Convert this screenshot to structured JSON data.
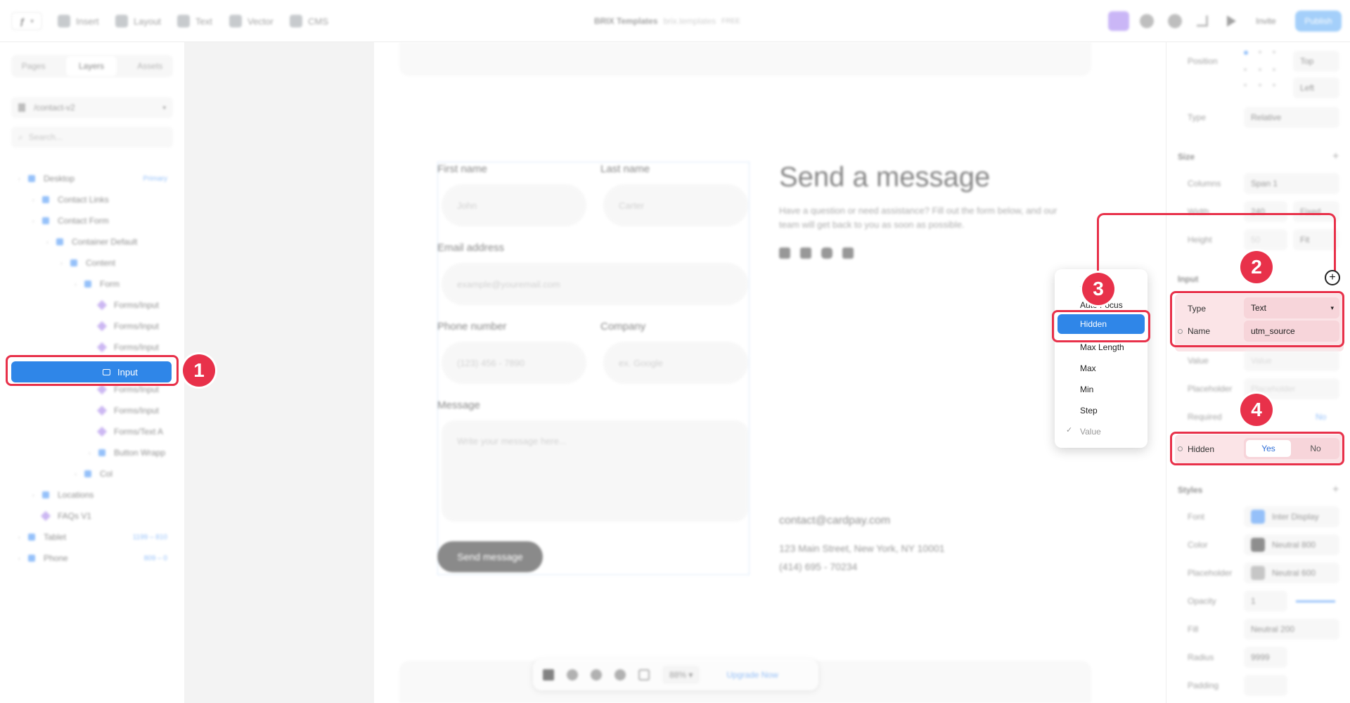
{
  "toolbar": {
    "menu": [
      "Insert",
      "Layout",
      "Text",
      "Vector",
      "CMS"
    ],
    "project": "BRIX Templates",
    "domain": "brix.templates",
    "plan": "FREE",
    "invite": "Invite",
    "publish": "Publish"
  },
  "left_panel": {
    "tabs": [
      "Pages",
      "Layers",
      "Assets"
    ],
    "page_select": "/contact-v2",
    "search_placeholder": "Search...",
    "layers": [
      {
        "label": "Desktop",
        "tag": "Primary",
        "kind": "frame",
        "indent": 0
      },
      {
        "label": "Contact Links",
        "kind": "frame",
        "indent": 1
      },
      {
        "label": "Contact Form",
        "kind": "frame",
        "indent": 1
      },
      {
        "label": "Container Default",
        "kind": "frame",
        "indent": 2
      },
      {
        "label": "Content",
        "kind": "frame",
        "indent": 3
      },
      {
        "label": "Form",
        "kind": "frame",
        "indent": 4
      },
      {
        "label": "Forms/Input",
        "kind": "component",
        "indent": 5
      },
      {
        "label": "Forms/Input",
        "kind": "component",
        "indent": 5
      },
      {
        "label": "Forms/Input",
        "kind": "component",
        "indent": 5
      },
      {
        "label": "Input",
        "kind": "input",
        "indent": 5,
        "selected": true
      },
      {
        "label": "Forms/Input",
        "kind": "component",
        "indent": 5
      },
      {
        "label": "Forms/Input",
        "kind": "component",
        "indent": 5
      },
      {
        "label": "Forms/Text A",
        "kind": "component",
        "indent": 5
      },
      {
        "label": "Button Wrapp",
        "kind": "frame",
        "indent": 5
      },
      {
        "label": "Col",
        "kind": "frame",
        "indent": 4
      },
      {
        "label": "Locations",
        "kind": "frame",
        "indent": 1
      },
      {
        "label": "FAQs V1",
        "kind": "component",
        "indent": 1
      },
      {
        "label": "Tablet",
        "tag": "1199 – 810",
        "kind": "frame",
        "indent": 0
      },
      {
        "label": "Phone",
        "tag": "809 – 0",
        "kind": "frame",
        "indent": 0
      }
    ]
  },
  "form": {
    "first_name": {
      "label": "First name",
      "placeholder": "John"
    },
    "last_name": {
      "label": "Last name",
      "placeholder": "Carter"
    },
    "email": {
      "label": "Email address",
      "placeholder": "example@youremail.com"
    },
    "phone": {
      "label": "Phone number",
      "placeholder": "(123) 456 - 7890"
    },
    "company": {
      "label": "Company",
      "placeholder": "ex. Google"
    },
    "message": {
      "label": "Message",
      "placeholder": "Write your message here..."
    },
    "submit": "Send message"
  },
  "contact": {
    "title": "Send a message",
    "subtitle": "Have a question or need assistance? Fill out the form below, and our team will get back to you as soon as possible.",
    "email": "contact@cardpay.com",
    "address": "123 Main Street, New York, NY 10001",
    "phone": "(414) 695 - 70234"
  },
  "dropdown": {
    "items": [
      "A",
      "Auto Focus",
      "Hidden",
      "Max Length",
      "Max",
      "Min",
      "Step",
      "Value"
    ],
    "selected": "Hidden",
    "checked": "Value"
  },
  "right_panel": {
    "position_label": "Position",
    "pos_v": "Top",
    "pos_h": "Left",
    "type_label": "Type",
    "type_value": "Relative",
    "size_section": "Size",
    "columns_label": "Columns",
    "columns_value": "Span 1",
    "width_label": "Width",
    "width_value": "240",
    "width_mode": "Fixed",
    "height_label": "Height",
    "height_value": "50",
    "height_mode": "Fit",
    "input_section": "Input",
    "input_type_label": "Type",
    "input_type_value": "Text",
    "name_label": "Name",
    "name_value": "utm_source",
    "value_label": "Value",
    "value_placeholder": "Value",
    "placeholder_label": "Placeholder",
    "placeholder_placeholder": "Placeholder",
    "required_label": "Required",
    "required_no": "No",
    "hidden_label": "Hidden",
    "hidden_yes": "Yes",
    "hidden_no": "No",
    "styles_section": "Styles",
    "font_label": "Font",
    "font_value": "Inter Display",
    "color_label": "Color",
    "color_value": "Neutral 800",
    "ph_color_label": "Placeholder",
    "ph_color_value": "Neutral 600",
    "opacity_label": "Opacity",
    "opacity_value": "1",
    "fill_label": "Fill",
    "fill_value": "Neutral 200",
    "radius_label": "Radius",
    "radius_value": "9999",
    "padding_label": "Padding"
  },
  "bottom_toolbar": {
    "zoom": "88%",
    "upgrade": "Upgrade Now"
  },
  "badges": [
    "1",
    "2",
    "3",
    "4"
  ],
  "colors": {
    "accent": "#e8314a",
    "selection": "#2f86e8",
    "brand": "#3f8ef5"
  }
}
